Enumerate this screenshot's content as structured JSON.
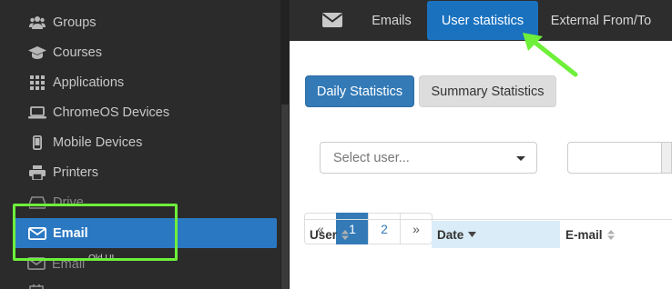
{
  "sidebar": {
    "items": [
      {
        "label": "Groups",
        "icon": "users-icon"
      },
      {
        "label": "Courses",
        "icon": "graduation-cap-icon"
      },
      {
        "label": "Applications",
        "icon": "grid-icon"
      },
      {
        "label": "ChromeOS Devices",
        "icon": "laptop-icon"
      },
      {
        "label": "Mobile Devices",
        "icon": "mobile-icon"
      },
      {
        "label": "Printers",
        "icon": "printer-icon"
      },
      {
        "label": "Drive",
        "icon": "drive-icon"
      },
      {
        "label": "Email",
        "icon": "envelope-icon",
        "active": true
      }
    ],
    "ghost_item": {
      "label": "Email",
      "sub": "Old UI"
    }
  },
  "topnav": {
    "tabs": [
      {
        "label": "Emails"
      },
      {
        "label": "User statistics",
        "active": true
      },
      {
        "label": "External From/To"
      }
    ]
  },
  "content": {
    "daily_button": "Daily Statistics",
    "summary_button": "Summary Statistics",
    "user_select_placeholder": "Select user...",
    "pagination": [
      "«",
      "1",
      "2",
      "»"
    ],
    "table_headers": [
      "User",
      "Date",
      "E-mail"
    ]
  },
  "colors": {
    "accent": "#337ab7",
    "highlight": "#6ef03a",
    "sidebar_bg": "#2b2b2b"
  }
}
